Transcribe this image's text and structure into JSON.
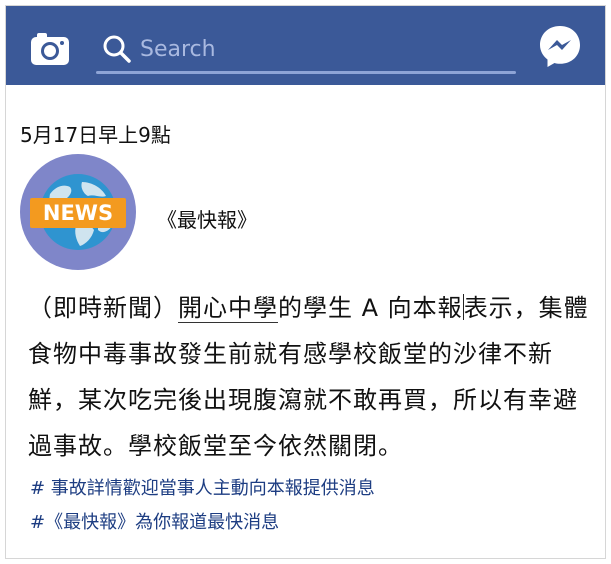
{
  "topbar": {
    "search_placeholder": "Search",
    "icons": [
      "camera-icon",
      "search-icon",
      "messenger-icon"
    ],
    "bg_color": "#3b5998"
  },
  "post": {
    "date": "5月17日早上9點",
    "avatar_badge": "NEWS",
    "source": "《最快報》",
    "body": {
      "prefix": "（即時新聞）",
      "school": "開心中學",
      "part2": "的學生 A 向本報",
      "part3": "表示，集體食物中毒事故發生前就有感學校飯堂的沙律不新鮮，某次吃完後出現腹瀉就不敢再買，所以有幸避過事故。學校飯堂至今依然關閉。"
    },
    "hashtags": [
      "# 事故詳情歡迎當事人主動向本報提供消息",
      "#《最快報》為你報道最快消息"
    ]
  }
}
